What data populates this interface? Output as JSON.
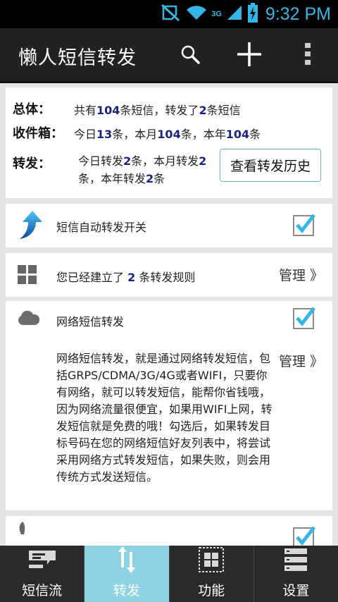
{
  "status_bar": {
    "time": "9:32 PM",
    "icons": [
      "no-sim-icon",
      "wifi-icon",
      "3g-icon",
      "signal-icon",
      "battery-charging-icon"
    ],
    "network_label": "3G",
    "accent_color": "#33b5e5"
  },
  "action_bar": {
    "title": "懒人短信转发",
    "actions": [
      "search-icon",
      "add-icon",
      "overflow-menu-icon"
    ]
  },
  "summary": {
    "overall_label": "总体：",
    "overall_pre": "共有",
    "overall_count": "104",
    "overall_mid": "条短信，转发了",
    "overall_forwarded": "2",
    "overall_post": "条短信",
    "inbox_label": "收件箱：",
    "inbox_today_pre": "今日",
    "inbox_today": "13",
    "inbox_today_post": "条，本月",
    "inbox_month": "104",
    "inbox_month_post": "条，本年",
    "inbox_year": "104",
    "inbox_year_post": "条",
    "forward_label": "转发：",
    "forward_today_pre": "今日转发",
    "forward_today": "2",
    "forward_month_pre": "条，本月转发",
    "forward_month": "2",
    "forward_year_pre": "条，本年转发",
    "forward_year": "2",
    "forward_year_post": "条",
    "history_button": "查看转发历史"
  },
  "auto_forward": {
    "label": "短信自动转发开关",
    "checked": true
  },
  "rules": {
    "pre": "您已经建立了",
    "count": "2",
    "post": "条转发规则",
    "manage": "管理 》"
  },
  "network_forward": {
    "title": "网络短信转发",
    "checked": true,
    "manage": "管理 》",
    "description": "网络短信转发，就是通过网络转发短信，包括GRPS/CDMA/3G/4G或者WIFI，只要你有网络，就可以转发短信，能帮你省钱哦，因为网络流量很便宜，如果用WIFI上网，转发短信就是免费的哦！勾选后，如果转发目标号码在您的网络短信好友列表中，将尝试采用网络方式转发短信，如果失败，则会用传统方式发送短信。"
  },
  "bottom_nav": {
    "tabs": [
      {
        "label": "短信流",
        "icon": "message-stream-icon",
        "active": false
      },
      {
        "label": "转发",
        "icon": "transfer-arrows-icon",
        "active": true
      },
      {
        "label": "功能",
        "icon": "grid-icon",
        "active": false
      },
      {
        "label": "设置",
        "icon": "settings-stack-icon",
        "active": false
      }
    ],
    "active_color": "#8ed3e3"
  }
}
